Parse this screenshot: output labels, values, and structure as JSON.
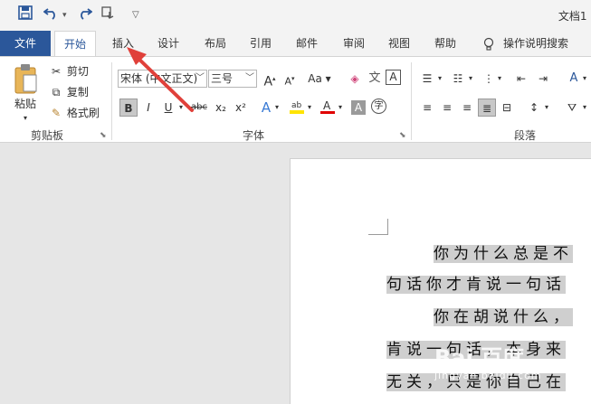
{
  "window": {
    "title": "文档1 ["
  },
  "qat": {
    "save_icon": "save-icon",
    "undo_icon": "undo-icon",
    "redo_icon": "redo-icon",
    "touch_icon": "touch-mode-icon",
    "customize_icon": "customize-icon"
  },
  "tabs": {
    "file": "文件",
    "home": "开始",
    "insert": "插入",
    "design": "设计",
    "layout": "布局",
    "references": "引用",
    "mailings": "邮件",
    "review": "审阅",
    "view": "视图",
    "help": "帮助",
    "tell_me": "操作说明搜索"
  },
  "clipboard": {
    "paste": "粘贴",
    "cut": "剪切",
    "copy": "复制",
    "format_painter": "格式刷",
    "label": "剪贴板"
  },
  "font": {
    "font_name": "宋体 (中文正文)",
    "font_size": "三号",
    "grow": "A",
    "shrink": "A",
    "change_case": "Aa",
    "bold": "B",
    "italic": "I",
    "underline": "U",
    "strike": "abc",
    "subscript": "x₂",
    "superscript": "x²",
    "char_border": "A",
    "char_shading": "A",
    "enclose": "字",
    "label": "字体"
  },
  "paragraph": {
    "label": "段落"
  },
  "document": {
    "lines": [
      "你为什么总是不",
      "句话你才肯说一句话",
      "你在胡说什么，",
      "肯说一句话，本身来",
      "无关，只是你自己在"
    ]
  },
  "watermark": {
    "brand": "Bai 百度",
    "site": "jingyan.baidu.com"
  },
  "colors": {
    "accent": "#2b579a",
    "arrow": "#e0403a",
    "highlight": "#cfcfcf"
  }
}
